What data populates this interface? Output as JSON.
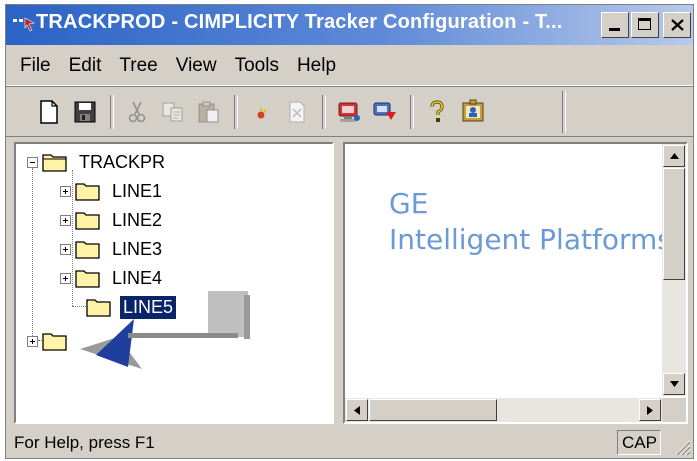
{
  "window": {
    "title": "TRACKPROD - CIMPLICITY Tracker Configuration - T..."
  },
  "menu": {
    "items": [
      "File",
      "Edit",
      "Tree",
      "View",
      "Tools",
      "Help"
    ]
  },
  "toolbar": {
    "icons": [
      "new-icon",
      "save-icon",
      "cut-icon",
      "copy-icon",
      "paste-icon",
      "new-node-icon",
      "delete-icon",
      "config-icon",
      "properties-icon",
      "help-icon",
      "about-icon"
    ]
  },
  "tree": {
    "root": "TRACKPR",
    "children": [
      "LINE1",
      "LINE2",
      "LINE3",
      "LINE4",
      "LINE5"
    ],
    "selected": "LINE5",
    "root_expander": "minus"
  },
  "content": {
    "brand_line1": "GE",
    "brand_line2": "Intelligent Platforms",
    "brand_color": "#6a9bd6"
  },
  "status": {
    "help_text": "For Help, press F1",
    "cap": "CAP"
  },
  "colors": {
    "titlebar_start": "#2a63c6",
    "selection": "#0a246a",
    "callout_arrow": "#1f3f9c"
  }
}
